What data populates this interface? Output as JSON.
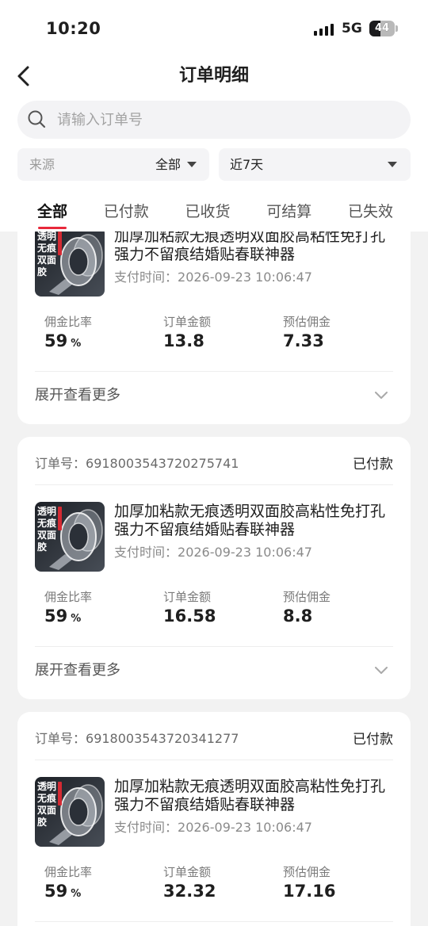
{
  "status_bar": {
    "time": "10:20",
    "network": "5G",
    "battery_level": 44
  },
  "header": {
    "title": "订单明细"
  },
  "search": {
    "placeholder": "请输入订单号"
  },
  "filters": {
    "source_label": "来源",
    "source_value": "全部",
    "date_value": "近7天"
  },
  "tabs": [
    "全部",
    "已付款",
    "已收货",
    "可结算",
    "已失效"
  ],
  "active_tab": 0,
  "labels": {
    "order_no_prefix": "订单号：",
    "pay_time_prefix": "支付时间：",
    "commission_rate": "佣金比率",
    "order_amount": "订单金额",
    "estimated_commission": "预估佣金",
    "expand": "展开查看更多",
    "percent": "%"
  },
  "orders": [
    {
      "product_image_text": "透明无痕双面胶",
      "product_title": "加厚加粘款无痕透明双面胶高粘性免打孔强力不留痕结婚贴春联神器",
      "pay_time": "2026-09-23 10:06:47",
      "commission_rate": "59",
      "order_amount": "13.8",
      "estimated_commission": "7.33"
    },
    {
      "order_no": "6918003543720275741",
      "status": "已付款",
      "product_image_text": "透明无痕双面胶",
      "product_title": "加厚加粘款无痕透明双面胶高粘性免打孔强力不留痕结婚贴春联神器",
      "pay_time": "2026-09-23 10:06:47",
      "commission_rate": "59",
      "order_amount": "16.58",
      "estimated_commission": "8.8"
    },
    {
      "order_no": "6918003543720341277",
      "status": "已付款",
      "product_image_text": "透明无痕双面胶",
      "product_title": "加厚加粘款无痕透明双面胶高粘性免打孔强力不留痕结婚贴春联神器",
      "pay_time": "2026-09-23 10:06:47",
      "commission_rate": "59",
      "order_amount": "32.32",
      "estimated_commission": "17.16"
    }
  ],
  "colors": {
    "accent": "#e8283b",
    "background": "#f2f2f2",
    "card": "#ffffff",
    "text": "#1f1f1f",
    "muted": "#8a8a8a"
  }
}
